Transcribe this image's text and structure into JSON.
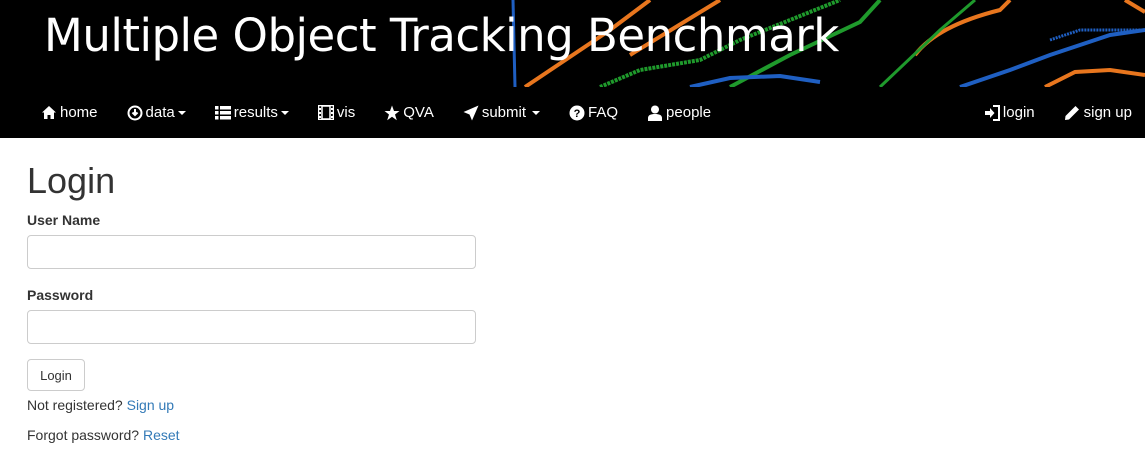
{
  "banner": {
    "title": "Multiple Object Tracking Benchmark"
  },
  "nav": {
    "left": [
      {
        "label": "home",
        "icon": "home-icon",
        "dropdown": false
      },
      {
        "label": "data",
        "icon": "download-icon",
        "dropdown": true
      },
      {
        "label": "results",
        "icon": "list-icon",
        "dropdown": true
      },
      {
        "label": "vis",
        "icon": "film-icon",
        "dropdown": false
      },
      {
        "label": "QVA",
        "icon": "star-icon",
        "dropdown": false
      },
      {
        "label": "submit",
        "icon": "send-icon",
        "dropdown": true
      },
      {
        "label": "FAQ",
        "icon": "question-icon",
        "dropdown": false
      },
      {
        "label": "people",
        "icon": "user-icon",
        "dropdown": false
      }
    ],
    "right": [
      {
        "label": "login",
        "icon": "log-in-icon"
      },
      {
        "label": "sign up",
        "icon": "pencil-icon"
      }
    ]
  },
  "form": {
    "title": "Login",
    "username_label": "User Name",
    "username_value": "",
    "password_label": "Password",
    "password_value": "",
    "submit_label": "Login",
    "register_prompt": "Not registered?",
    "register_link": "Sign up",
    "forgot_prompt": "Forgot password?",
    "forgot_link": "Reset"
  },
  "colors": {
    "navbar_bg": "#000000",
    "link": "#337ab7",
    "text": "#333333",
    "banner_orange": "#e8761e",
    "banner_green": "#1f9a2c",
    "banner_blue": "#1f5fc2"
  }
}
